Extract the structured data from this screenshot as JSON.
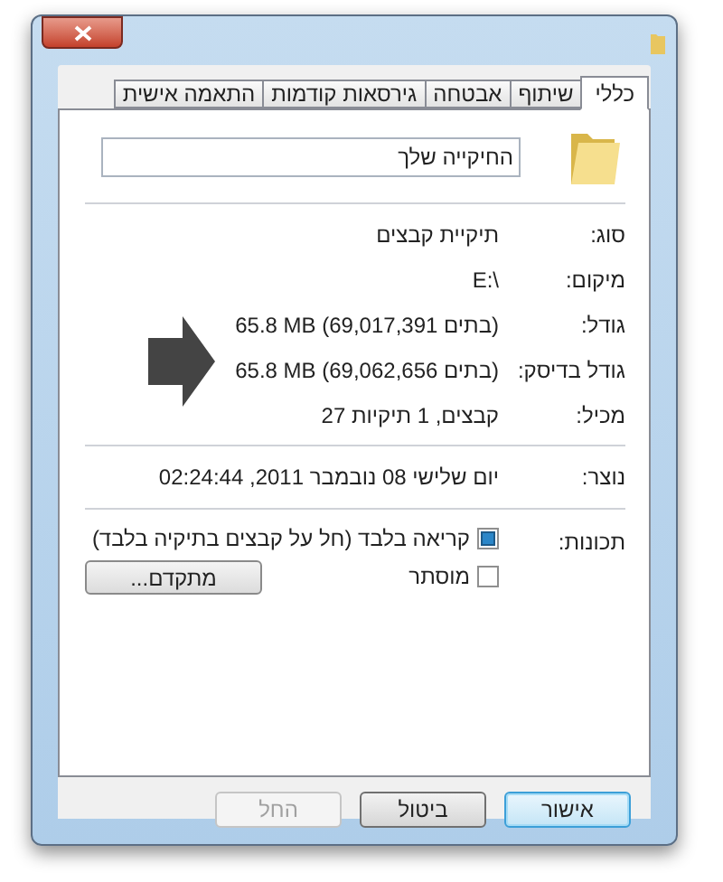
{
  "tabs": [
    {
      "label": "כללי",
      "selected": true
    },
    {
      "label": "שיתוף",
      "selected": false
    },
    {
      "label": "אבטחה",
      "selected": false
    },
    {
      "label": "גירסאות קודמות",
      "selected": false
    },
    {
      "label": "התאמה אישית",
      "selected": false
    }
  ],
  "name_field": {
    "value": "החיקייה שלך"
  },
  "groups": [
    [
      {
        "label": "סוג:",
        "value": "תיקיית קבצים"
      },
      {
        "label": "מיקום:",
        "value": "E:\\"
      },
      {
        "label": "גודל:",
        "value": "65.8 MB (69,017,391 בתים)"
      },
      {
        "label": "גודל בדיסק:",
        "value": "65.8 MB (69,062,656 בתים)"
      },
      {
        "label": "מכיל:",
        "value": "קבצים, 1 תיקיות 27"
      }
    ],
    [
      {
        "label": "נוצר:",
        "value": "יום שלישי 08 נובמבר 2011, 02:24:44"
      }
    ]
  ],
  "attributes": {
    "label": "תכונות:",
    "options": [
      {
        "label": "קריאה בלבד (חל על קבצים בתיקיה בלבד)",
        "indeterminate": true
      },
      {
        "label": "מוסתר",
        "indeterminate": false
      }
    ],
    "advanced_button": "מתקדם..."
  },
  "buttons": [
    {
      "label": "אישור",
      "default": true,
      "disabled": false
    },
    {
      "label": "ביטול",
      "default": false,
      "disabled": false
    },
    {
      "label": "החל",
      "default": false,
      "disabled": true
    }
  ]
}
